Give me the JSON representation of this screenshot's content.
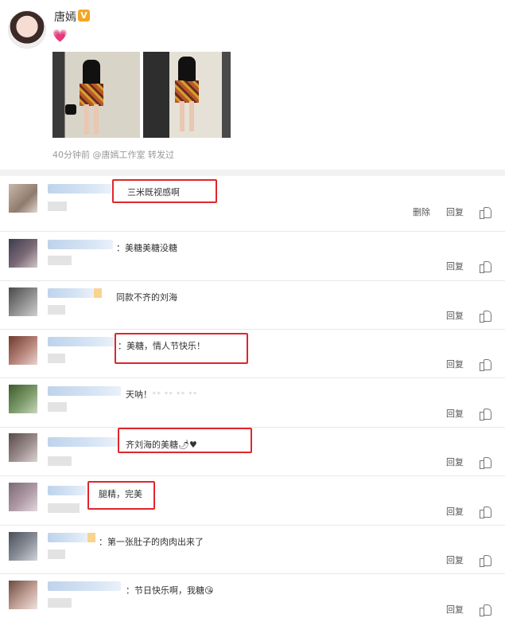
{
  "post": {
    "author": "唐嫣",
    "verified_badge": "V",
    "emoji_icon": "heart-icon",
    "meta": "40分钟前 @唐嫣工作室 转发过"
  },
  "comments": [
    {
      "text": "三米既视感啊",
      "actions": [
        "删除",
        "回复"
      ],
      "highlighted": true
    },
    {
      "text": "：美糖美糖没糖",
      "actions": [
        "回复"
      ],
      "highlighted": false
    },
    {
      "text": "同款不齐的刘海",
      "actions": [
        "回复"
      ],
      "highlighted": false
    },
    {
      "text": "：美糖，情人节快乐！",
      "actions": [
        "回复"
      ],
      "highlighted": true
    },
    {
      "text": "天呐！",
      "sparkles": "⁺⁺ ⁺⁺ ⁺⁺ ⁺⁺",
      "actions": [
        "回复"
      ],
      "highlighted": false
    },
    {
      "text": "齐刘海的美糖",
      "tail": "🌶♥",
      "actions": [
        "回复"
      ],
      "highlighted": true
    },
    {
      "text": "腿精，完美",
      "actions": [
        "回复"
      ],
      "highlighted": true
    },
    {
      "text": "：第一张肚子的肉肉出来了",
      "actions": [
        "回复"
      ],
      "highlighted": false
    },
    {
      "text": "：节日快乐啊，我糖",
      "emoji": "😘",
      "actions": [
        "回复"
      ],
      "highlighted": false
    }
  ],
  "colors": {
    "highlight": "#e0262b",
    "link_blur": "#bed3ec",
    "badge": "#f4a623",
    "heart": "#f06f9b"
  }
}
